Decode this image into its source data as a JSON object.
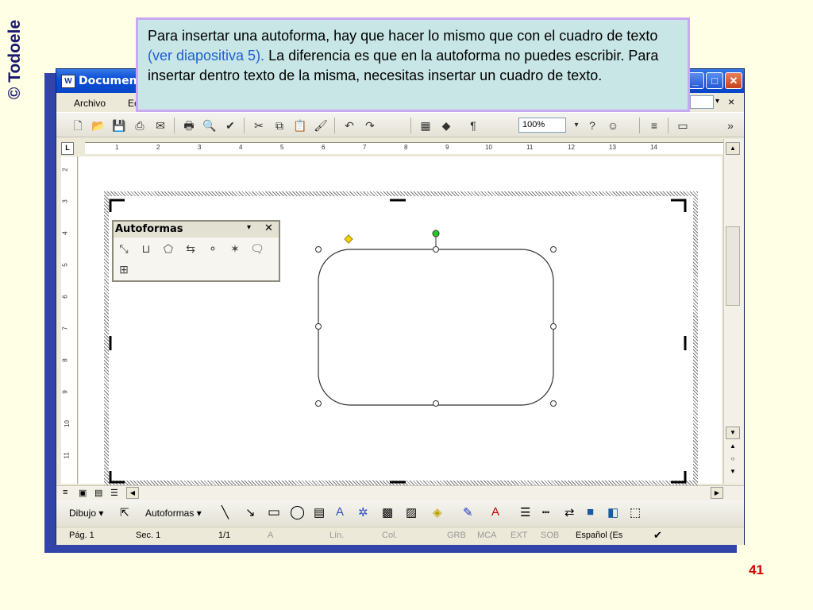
{
  "slide": {
    "brand": "© Todoele",
    "page_number": "41",
    "callout": {
      "text_before": "Para insertar una autoforma, hay que hacer lo mismo que con el cuadro de texto ",
      "link_text": "(ver diapositiva 5).",
      "text_after": " La diferencia es que en la autoforma no puedes escribir. Para insertar dentro texto de la misma, necesitas insertar un cuadro de texto."
    }
  },
  "window": {
    "title": "Documen",
    "menu": {
      "file": "Archivo",
      "edit": "Ec"
    },
    "menu_close": "×",
    "zoom": "100%",
    "ruler_numbers": [
      "1",
      "2",
      "3",
      "4",
      "5",
      "6",
      "7",
      "8",
      "9",
      "10",
      "11",
      "12",
      "13",
      "14"
    ],
    "vruler_numbers": [
      "2",
      "3",
      "4",
      "5",
      "6",
      "7",
      "8",
      "9",
      "10",
      "11"
    ],
    "draw_toolbar": {
      "dibujo": "Dibujo",
      "autoformas": "Autoformas"
    },
    "autoformas_panel": {
      "title": "Autoformas"
    },
    "status": {
      "page": "Pág. 1",
      "section": "Sec. 1",
      "pages": "1/1",
      "at": "A",
      "line": "Lín.",
      "col": "Col.",
      "grb": "GRB",
      "mca": "MCA",
      "ext": "EXT",
      "sob": "SOB",
      "language": "Español (Es"
    }
  },
  "colors": {
    "slide_bg": "#ffffe6",
    "brand": "#1a1a6e",
    "page_number": "#d40000",
    "callout_bg": "#c8e6e6",
    "callout_border": "#c8a8f0",
    "link": "#1f5fd0",
    "titlebar": "#0b4fd6"
  }
}
